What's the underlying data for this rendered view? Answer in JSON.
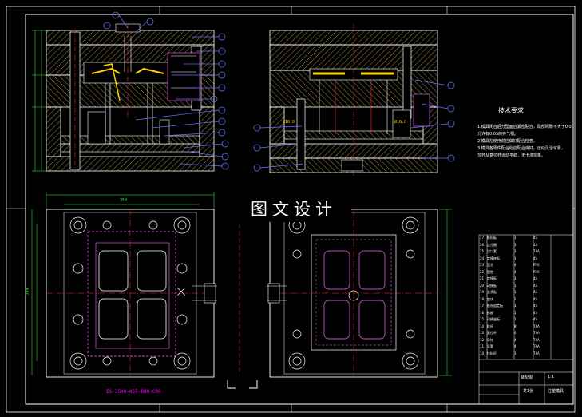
{
  "watermark": {
    "text": "图文设计"
  },
  "technical_requirements": {
    "title": "技术要求",
    "lines": [
      "1.模具闭合后分型面应紧密贴合，局部间隙不大于0.02mm，",
      "允许有0.05的排气槽。",
      "2.模具在使用前应做好配合检查。",
      "3.模具各零件配合处应配合良好，运动灵活可靠，",
      "顶杆及复位杆运动平稳，无卡滞现象。"
    ]
  },
  "cross_section_labels": {
    "left": "Ø16.0",
    "right": "Ø16.0"
  },
  "mold_code": "IS-3540-A55-B80-C90",
  "dimensions": {
    "overall_width": "350",
    "overall_height": "300"
  },
  "bom": {
    "rows": [
      [
        "27",
        "推料板",
        "1",
        "45",
        ""
      ],
      [
        "26",
        "定位圈",
        "1",
        "45",
        ""
      ],
      [
        "25",
        "浇口套",
        "1",
        "T8A",
        ""
      ],
      [
        "24",
        "定模座板",
        "1",
        "45",
        ""
      ],
      [
        "23",
        "型芯",
        "4",
        "P20",
        ""
      ],
      [
        "22",
        "型腔",
        "4",
        "P20",
        ""
      ],
      [
        "21",
        "定模板",
        "1",
        "45",
        ""
      ],
      [
        "20",
        "动模板",
        "1",
        "45",
        ""
      ],
      [
        "19",
        "支承板",
        "1",
        "45",
        ""
      ],
      [
        "18",
        "垫块",
        "2",
        "45",
        ""
      ],
      [
        "17",
        "推杆固定板",
        "1",
        "45",
        ""
      ],
      [
        "16",
        "推板",
        "1",
        "45",
        ""
      ],
      [
        "15",
        "动模座板",
        "1",
        "45",
        ""
      ],
      [
        "14",
        "推杆",
        "8",
        "T8A",
        ""
      ],
      [
        "13",
        "复位杆",
        "4",
        "T8A",
        ""
      ],
      [
        "12",
        "导柱",
        "4",
        "T8A",
        ""
      ],
      [
        "11",
        "导套",
        "4",
        "T8A",
        ""
      ],
      [
        "10",
        "拉料杆",
        "1",
        "T8A",
        ""
      ]
    ],
    "title_block": {
      "drawing": "装配图",
      "name": "注塑模具",
      "scale": "1:1",
      "sheet": "共1张"
    }
  },
  "colors": {
    "bg": "#000000",
    "outline": "#ffffff",
    "hatch": "#c8b45a",
    "dim": "#33ff33",
    "center": "#ff3333",
    "cavity": "#ff66ff",
    "balloon": "#6677ff",
    "yellow": "#ffd400"
  }
}
